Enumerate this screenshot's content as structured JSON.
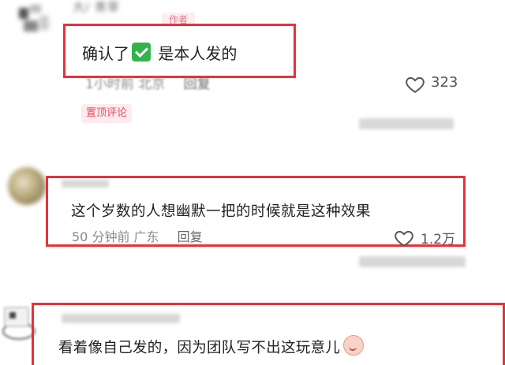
{
  "comments": [
    {
      "username": "大/ 青草",
      "author_tag": "作者",
      "text_before_icon": "确认了",
      "icon": "check-mark-button-icon",
      "text_after_icon": " 是本人发的",
      "time": "1小时前",
      "location": "北京",
      "reply_label": "回复",
      "likes": "323",
      "pinned_label": "置顶评论"
    },
    {
      "text": "这个岁数的人想幽默一把的时候就是这种效果",
      "time": "50 分钟前",
      "location": "广东",
      "reply_label": "回复",
      "likes": "1.2万"
    },
    {
      "text": "看着像自己发的，因为团队写不出这玩意儿",
      "emoji": "laughing-face-icon"
    }
  ],
  "colors": {
    "highlight_box": "#e5323b",
    "pinned_tag_text": "#e8495c",
    "pinned_tag_bg": "#fdecee",
    "meta_text": "#8a8a8a"
  },
  "icons": [
    "heart-outline-icon",
    "check-mark-button-icon",
    "laughing-face-icon"
  ]
}
